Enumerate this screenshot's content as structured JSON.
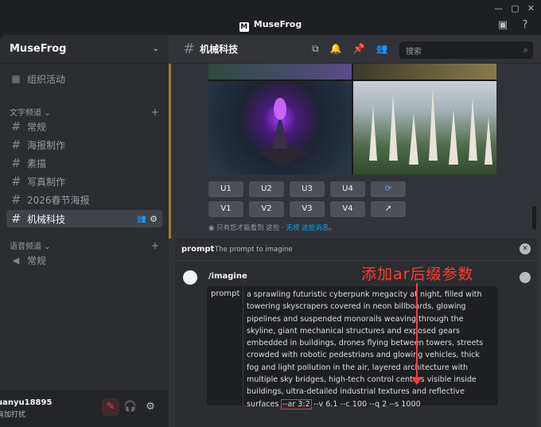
{
  "app": {
    "title": "MuseFrog",
    "logo_letter": "M"
  },
  "window_controls": [
    "—",
    "▢",
    "✕"
  ],
  "sidebar": {
    "server_name": "MuseFrog",
    "events_label": "组织活动",
    "text_category": "文字频道",
    "channels": [
      {
        "name": "常规"
      },
      {
        "name": "海报制作"
      },
      {
        "name": "素描"
      },
      {
        "name": "写真制作"
      },
      {
        "name": "2026春节海报"
      },
      {
        "name": "机械科技",
        "active": true
      }
    ],
    "voice_category": "语音频道",
    "voice_channels": [
      {
        "name": "常规"
      }
    ],
    "user": {
      "name": "uanyu18895",
      "status": "有加打扰"
    }
  },
  "channel": {
    "name": "机械科技",
    "search_placeholder": "搜索"
  },
  "buttons": {
    "upscale": [
      "U1",
      "U2",
      "U3",
      "U4"
    ],
    "variation": [
      "V1",
      "V2",
      "V3",
      "V4"
    ]
  },
  "ephemeral_note": {
    "prefix": "只有您才能看到 这些 · ",
    "link": "无视 这些消息",
    "suffix": "。"
  },
  "command": {
    "name": "prompt",
    "description": "The prompt to imagine",
    "command": "/imagine",
    "option_label": "prompt",
    "prompt_before": "a sprawling futuristic cyberpunk megacity at night, filled with towering skyscrapers covered in neon billboards, glowing pipelines and suspended monorails weaving through the skyline, giant mechanical structures and exposed gears embedded in buildings, drones flying between towers, streets crowded with robotic pedestrians and glowing vehicles, thick fog and light pollution in the air, layered architecture with multiple sky bridges, high-tech control centers visible inside buildings, ultra-detailed industrial textures and reflective surfaces ",
    "prompt_highlight": "--ar 3:2",
    "prompt_after": " --v 6.1 --c 100 --q 2 --s 1000"
  },
  "annotation": {
    "text": "添加ar后缀参数",
    "color": "#ff3b30"
  }
}
